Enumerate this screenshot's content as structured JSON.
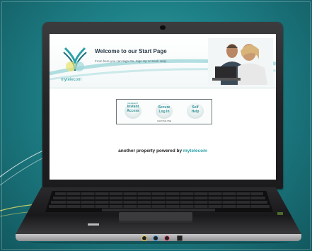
{
  "page": {
    "title": "Welcome to our Start Page",
    "subtitle": "From here you can Sign On, Sign Up or Seek Help",
    "logo_text": "mytelecom"
  },
  "buttons": [
    {
      "small": "RESIDENT",
      "line1": "Instant",
      "line2": "Access"
    },
    {
      "small": "",
      "line1": "Secure",
      "line2": "Log In"
    },
    {
      "small": "",
      "line1": "Self",
      "line2": "Help"
    }
  ],
  "panel_footer": "CHOOSE ONE",
  "footer": {
    "prefix": "another property powered by",
    "brand": "mytelecom"
  },
  "colors": {
    "accent": "#2aa0a6",
    "background": "#1e8087"
  }
}
